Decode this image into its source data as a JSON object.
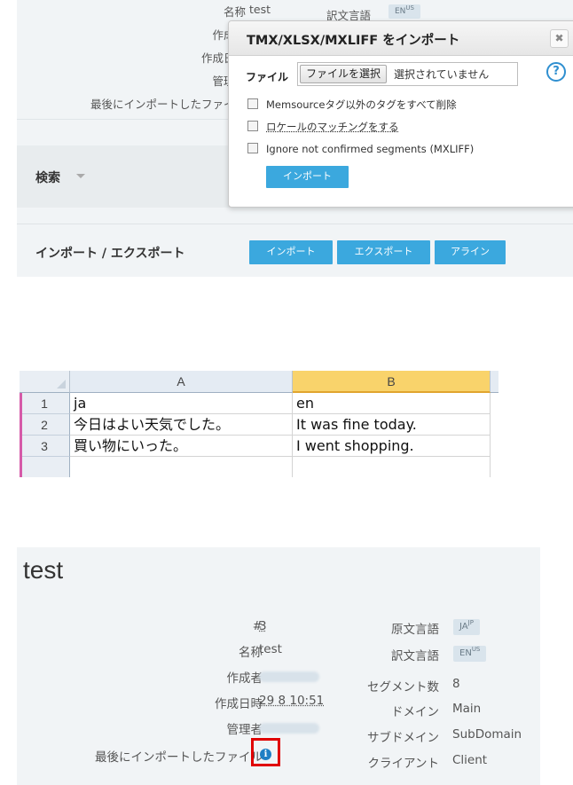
{
  "panel1": {
    "info_fields": [
      {
        "label": "名称",
        "value": "test"
      },
      {
        "label": "作成者",
        "value": ""
      },
      {
        "label": "作成日時",
        "value": ""
      },
      {
        "label": "管理者",
        "value": ""
      },
      {
        "label": "最後にインポートしたファイル",
        "value": ""
      }
    ],
    "target_lang_label": "訳文言語",
    "target_lang_badge": {
      "code": "EN",
      "region": "US"
    },
    "search_label": "検索",
    "import_export_label": "インポート / エクスポート",
    "buttons": {
      "import": "インポート",
      "export": "エクスポート",
      "align": "アライン"
    },
    "dialog": {
      "title": "TMX/XLSX/MXLIFF をインポート",
      "close_glyph": "✖",
      "file_label": "ファイル",
      "file_button": "ファイルを選択",
      "file_status": "選択されていません",
      "help_glyph": "?",
      "options": [
        {
          "label": "Memsourceタグ以外のタグをすべて削除",
          "checked": false
        },
        {
          "label": "ロケールのマッチングをする",
          "checked": false
        },
        {
          "label": "Ignore not confirmed segments (MXLIFF)",
          "checked": false
        }
      ],
      "import_button": "インポート"
    }
  },
  "spreadsheet": {
    "columns": [
      "A",
      "B"
    ],
    "rows": [
      {
        "num": "1",
        "a": "ja",
        "b": "en"
      },
      {
        "num": "2",
        "a": "今日はよい天気でした。",
        "b": "It was fine today."
      },
      {
        "num": "3",
        "a": "買い物にいった。",
        "b": "I went shopping."
      }
    ]
  },
  "panel3": {
    "title": "test",
    "left_fields": [
      {
        "label": "#",
        "value": "3"
      },
      {
        "label": "名称",
        "value": "test"
      },
      {
        "label": "作成者",
        "value": ""
      },
      {
        "label": "作成日時",
        "value": "29 8 10:51"
      },
      {
        "label": "管理者",
        "value": ""
      },
      {
        "label": "最後にインポートしたファイル",
        "value": ""
      }
    ],
    "info_glyph": "i",
    "right_fields": [
      {
        "label": "原文言語",
        "badge": {
          "code": "JA",
          "region": "JP"
        }
      },
      {
        "label": "訳文言語",
        "badge": {
          "code": "EN",
          "region": "US"
        }
      },
      {
        "label": "セグメント数",
        "value": "8"
      },
      {
        "label": "ドメイン",
        "value": "Main"
      },
      {
        "label": "サブドメイン",
        "value": "SubDomain"
      },
      {
        "label": "クライアント",
        "value": "Client"
      }
    ]
  },
  "colors": {
    "accent_blue": "#3ba8de",
    "panel_bg": "#f1f4f6",
    "highlight_red": "#e00000",
    "selected_column": "#f9d36b"
  }
}
